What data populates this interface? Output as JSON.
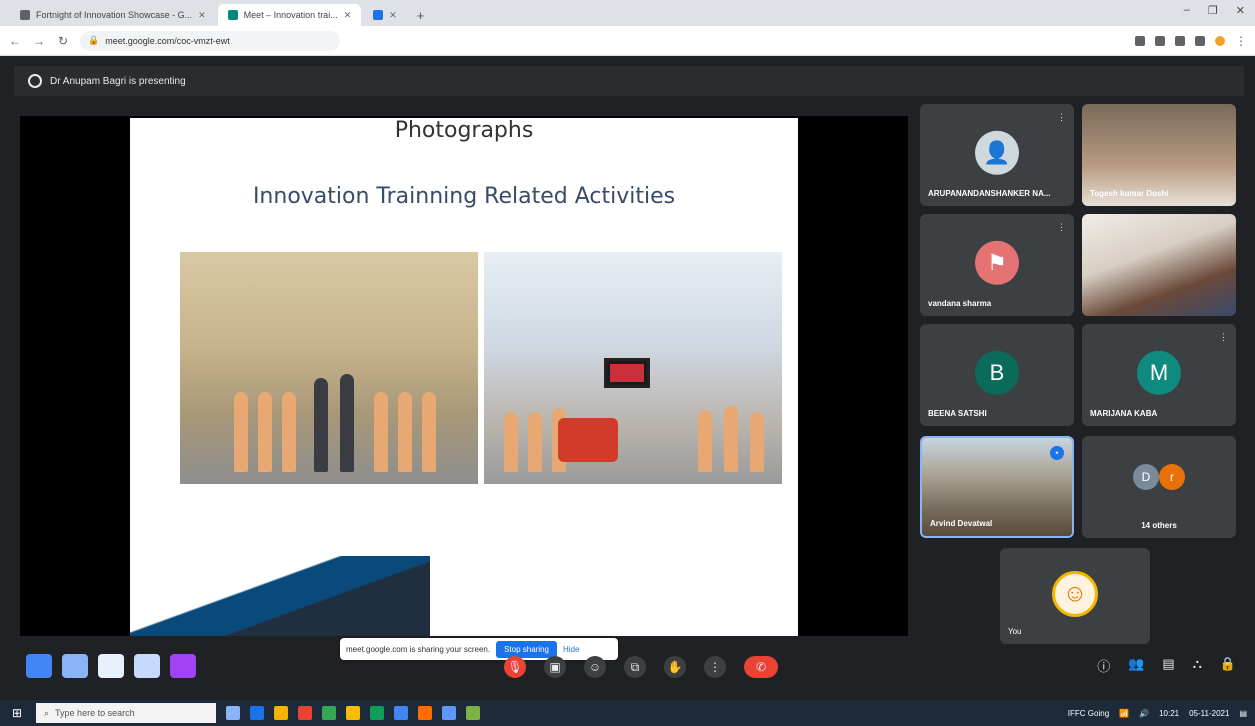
{
  "browser": {
    "tabs": [
      {
        "label": "Fortnight of Innovation Showcase - G..."
      },
      {
        "label": "Meet – Innovation trai..."
      },
      {
        "label": ""
      }
    ],
    "url": "meet.google.com/coc-vmzt-ewt",
    "new_tab_symbol": "+",
    "window_controls": [
      "–",
      "❐",
      "✕"
    ]
  },
  "meet": {
    "presenting_banner": "Dr Anupam Bagri is presenting",
    "slide": {
      "title": "Photographs",
      "subtitle": "Innovation Trainning Related Activities"
    },
    "share_banner": {
      "text": "meet.google.com is sharing your screen.",
      "stop_label": "Stop sharing",
      "hide_label": "Hide"
    },
    "participants": [
      {
        "name": "ARUPANANDANSHANKER NA...",
        "type": "photo"
      },
      {
        "name": "Togesh kumar Doshi",
        "type": "video"
      },
      {
        "name": "vandana sharma",
        "type": "photo"
      },
      {
        "name": "",
        "type": "video"
      },
      {
        "name": "BEENA SATSHI",
        "type": "initial",
        "initial": "B",
        "color": "#0b6b5a"
      },
      {
        "name": "MARIJANA KABA",
        "type": "initial",
        "initial": "M",
        "color": "#0f8a7e"
      },
      {
        "name": "Arvind Devatwal",
        "type": "video"
      },
      {
        "name": "14 others",
        "type": "others",
        "initials": [
          "D",
          "r"
        ]
      }
    ],
    "self_tile": {
      "name": "You"
    },
    "mic_icon_glyph": "✎",
    "controls_center": [
      "🎙",
      "▣",
      "☺",
      "⧉",
      "✋",
      "⋮",
      "✆"
    ],
    "controls_right": [
      "ⓘ",
      "👥",
      "▤",
      "⛬",
      "🔒"
    ]
  },
  "taskbar": {
    "search_placeholder": "Type here to search",
    "tray_text": "IFFC Going",
    "time": "10:21",
    "date": "05-11-2021"
  }
}
